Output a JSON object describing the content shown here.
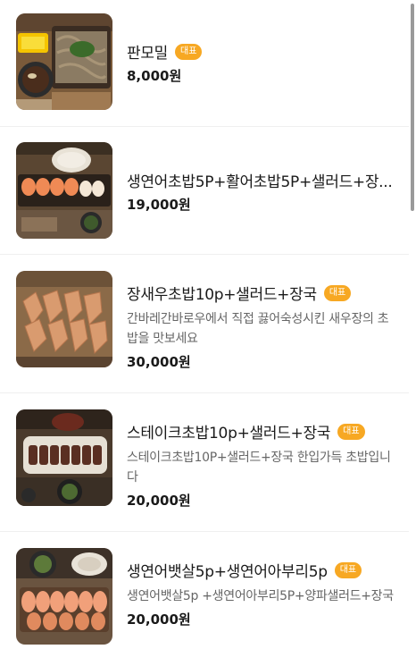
{
  "menu": {
    "items": [
      {
        "name": "판모밀",
        "badge": "대표",
        "description": "",
        "price": "8,000원",
        "image_icon": "soba-noodle-photo"
      },
      {
        "name": "생연어초밥5P+활어초밥5P+샐러드+장...",
        "badge": "",
        "description": "",
        "price": "19,000원",
        "image_icon": "salmon-sushi-platter-photo"
      },
      {
        "name": "장새우초밥10p+샐러드+장국",
        "badge": "대표",
        "description": "간바레간바로우에서 직접 끓어숙성시킨 새우장의 초밥을 맛보세요",
        "price": "30,000원",
        "image_icon": "shrimp-sushi-photo"
      },
      {
        "name": "스테이크초밥10p+샐러드+장국",
        "badge": "대표",
        "description": "스테이크초밥10P+샐러드+장국 한입가득 초밥입니다",
        "price": "20,000원",
        "image_icon": "steak-sushi-photo"
      },
      {
        "name": "생연어뱃살5p+생연어아부리5p",
        "badge": "대표",
        "description": "생연어뱃살5p +생연어아부리5P+양파샐러드+장국",
        "price": "20,000원",
        "image_icon": "salmon-belly-sushi-photo"
      }
    ]
  },
  "colors": {
    "badge": "#f7a823",
    "price": "#1a1a1a",
    "description": "#666666"
  }
}
